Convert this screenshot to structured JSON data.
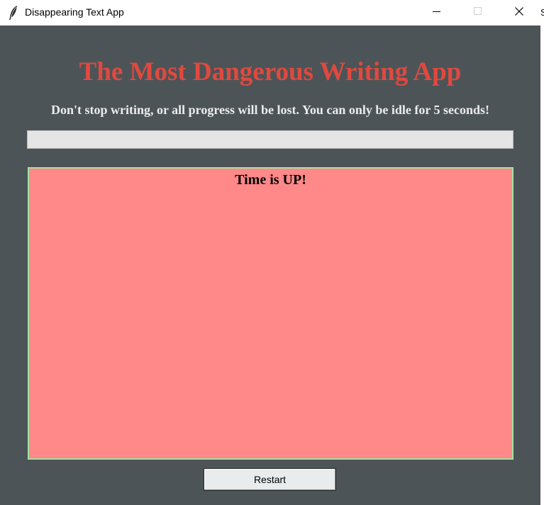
{
  "window": {
    "title": "Disappearing Text App",
    "app_icon": "feather-icon",
    "controls": [
      "minimize-icon",
      "maximize-icon",
      "close-icon"
    ],
    "edge_clip_text": "S"
  },
  "header": {
    "title": "The Most Dangerous Writing App",
    "subtitle": "Don't stop writing, or all progress will be lost. You can only be idle for 5 seconds!"
  },
  "entry": {
    "value": ""
  },
  "text_area": {
    "content": "Time is UP!"
  },
  "restart_button": {
    "label": "Restart"
  },
  "colors": {
    "background": "#4d5457",
    "title": "#e0493f",
    "subtitle": "#ececec",
    "text_area_bg": "#ff8888",
    "text_area_border": "#9ee3a4"
  }
}
